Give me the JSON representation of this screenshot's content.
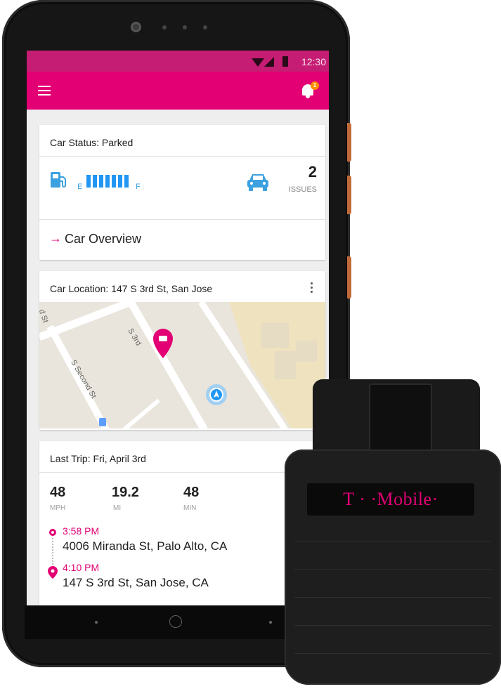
{
  "statusbar": {
    "time": "12:30"
  },
  "appbar": {
    "notification_count": "1"
  },
  "car_status": {
    "title": "Car Status: Parked",
    "fuel_empty_label": "E",
    "fuel_full_label": "F",
    "fuel_bars": 7,
    "issues_count": "2",
    "issues_label": "ISSUES",
    "overview_arrow": "→",
    "overview_label": "Car Overview"
  },
  "car_location": {
    "title": "Car Location: 147 S 3rd St, San Jose",
    "map_labels": [
      "d St",
      "S 3rd",
      "S Second St"
    ]
  },
  "last_trip": {
    "title": "Last Trip:  Fri, April 3rd",
    "stats": [
      {
        "value": "48",
        "unit": "MPH"
      },
      {
        "value": "19.2",
        "unit": "MI"
      },
      {
        "value": "48",
        "unit": "MIN"
      }
    ],
    "start_time": "3:58 PM",
    "start_address": "4006 Miranda St, Palo Alto, CA",
    "end_time": "4:10 PM",
    "end_address": "147 S 3rd St, San Jose, CA"
  },
  "device": {
    "brand_label": "T · ·Mobile·"
  },
  "colors": {
    "magenta": "#e20074",
    "blue": "#2196f3",
    "status_bar": "#c51d73"
  }
}
